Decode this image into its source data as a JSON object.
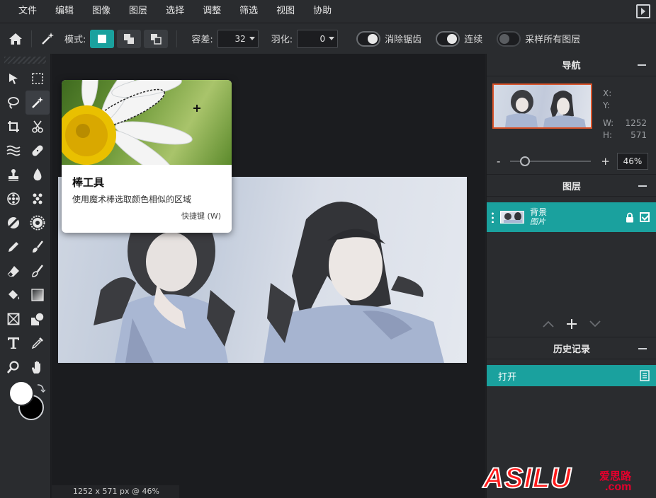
{
  "menu": [
    "文件",
    "编辑",
    "图像",
    "图层",
    "选择",
    "调整",
    "筛选",
    "视图",
    "协助"
  ],
  "options": {
    "mode_label": "模式:",
    "tolerance_label": "容差:",
    "tolerance_value": "32",
    "feather_label": "羽化:",
    "feather_value": "0",
    "antialias_label": "消除锯齿",
    "contiguous_label": "连续",
    "sample_all_label": "采样所有图层"
  },
  "tooltip": {
    "title": "棒工具",
    "description": "使用魔术棒选取颜色相似的区域",
    "shortcut": "快捷键 (W)"
  },
  "navigator": {
    "title": "导航",
    "x_label": "X:",
    "y_label": "Y:",
    "w_label": "W:",
    "w_value": "1252",
    "h_label": "H:",
    "h_value": "571",
    "zoom_minus": "-",
    "zoom_plus": "+",
    "zoom_value": "46%"
  },
  "layers": {
    "title": "图层",
    "items": [
      {
        "name": "背景",
        "type": "图片"
      }
    ]
  },
  "history": {
    "title": "历史记录",
    "items": [
      {
        "label": "打开"
      }
    ]
  },
  "status": {
    "text": "1252 x 571 px @ 46%"
  },
  "watermark": {
    "brand": "ASILU",
    "cn": "爱思路",
    "domain": ".com"
  },
  "colors": {
    "accent": "#1aa19e",
    "foreground": "#ffffff",
    "background": "#000000",
    "nav_frame": "#d9542b"
  }
}
